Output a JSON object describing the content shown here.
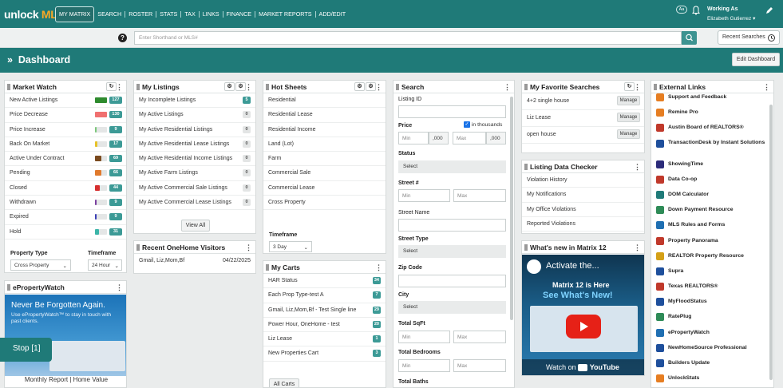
{
  "topbar": {
    "logo_unlock": "unlock",
    "logo_mls": "MLS",
    "nav": [
      "MY MATRIX",
      "SEARCH",
      "ROSTER",
      "STATS",
      "TAX",
      "LINKS",
      "FINANCE",
      "MARKET REPORTS",
      "ADD/EDIT"
    ],
    "aa": "Aa",
    "working_as": "Working As",
    "user": "Elizabeth Gutierrez"
  },
  "search": {
    "placeholder": "Enter Shorthand or MLS#",
    "recent": "Recent Searches"
  },
  "dashboard": {
    "title": "Dashboard",
    "edit": "Edit Dashboard"
  },
  "market_watch": {
    "title": "Market Watch",
    "rows": [
      {
        "label": "New Active Listings",
        "color": "#2e8b2e",
        "fill": 1.0,
        "count": "127"
      },
      {
        "label": "Price Decrease",
        "color": "#f07070",
        "fill": 1.0,
        "count": "130"
      },
      {
        "label": "Price Increase",
        "color": "#7bc77b",
        "fill": 0.15,
        "count": "9"
      },
      {
        "label": "Back On Market",
        "color": "#e6c229",
        "fill": 0.2,
        "count": "17"
      },
      {
        "label": "Active Under Contract",
        "color": "#7a4a1e",
        "fill": 0.55,
        "count": "69"
      },
      {
        "label": "Pending",
        "color": "#e07a2c",
        "fill": 0.55,
        "count": "66"
      },
      {
        "label": "Closed",
        "color": "#d62f2f",
        "fill": 0.4,
        "count": "44"
      },
      {
        "label": "Withdrawn",
        "color": "#7a3fa0",
        "fill": 0.12,
        "count": "9"
      },
      {
        "label": "Expired",
        "color": "#3b3fb5",
        "fill": 0.12,
        "count": "9"
      },
      {
        "label": "Hold",
        "color": "#3bb5a8",
        "fill": 0.3,
        "count": "31"
      }
    ],
    "property_type_label": "Property Type",
    "property_type_value": "Cross Property",
    "timeframe_label": "Timeframe",
    "timeframe_value": "24 Hour"
  },
  "epropertywatch": {
    "title": "ePropertyWatch",
    "headline": "Never Be Forgotten Again.",
    "subtext": "Use ePropertyWatch™ to stay in touch with past clients.",
    "stop": "Stop [1]",
    "caption": "Monthly Report | Home Value"
  },
  "my_listings": {
    "title": "My Listings",
    "rows": [
      {
        "label": "My Incomplete Listings",
        "count": "5",
        "zero": false
      },
      {
        "label": "My Active Listings",
        "count": "0",
        "zero": true
      },
      {
        "label": "My Active Residential Listings",
        "count": "0",
        "zero": true
      },
      {
        "label": "My Active Residential Lease Listings",
        "count": "0",
        "zero": true
      },
      {
        "label": "My Active Residential Income Listings",
        "count": "0",
        "zero": true
      },
      {
        "label": "My Active Farm Listings",
        "count": "0",
        "zero": true
      },
      {
        "label": "My Active Commercial Sale Listings",
        "count": "0",
        "zero": true
      },
      {
        "label": "My Active Commercial Lease Listings",
        "count": "0",
        "zero": true
      }
    ],
    "view_all": "View All"
  },
  "onehome": {
    "title": "Recent OneHome Visitors",
    "name": "Gmail, Liz,Mom,Bf",
    "date": "04/22/2025"
  },
  "hot_sheets": {
    "title": "Hot Sheets",
    "rows": [
      "Residential",
      "Residential Lease",
      "Residential Income",
      "Land (Lot)",
      "Farm",
      "Commercial Sale",
      "Commercial Lease",
      "Cross Property"
    ],
    "timeframe_label": "Timeframe",
    "timeframe_value": "3 Day"
  },
  "my_carts": {
    "title": "My Carts",
    "rows": [
      {
        "label": "HAR Status",
        "count": "34"
      },
      {
        "label": "Each Prop Type-test A",
        "count": "7"
      },
      {
        "label": "Gmail, Liz,Mom,Bf - Test Single line",
        "count": "29"
      },
      {
        "label": "Power Hour, OneHome - test",
        "count": "20"
      },
      {
        "label": "Liz Lease",
        "count": "1"
      },
      {
        "label": "New Properties Cart",
        "count": "3"
      }
    ],
    "all": "All Carts"
  },
  "search_panel": {
    "title": "Search",
    "listing_id": "Listing ID",
    "price": "Price",
    "in_thousands": "in thousands",
    "min": "Min",
    "max": "Max",
    "thousands_suffix": ",000",
    "status": "Status",
    "select": "Select",
    "street_no": "Street #",
    "street_name": "Street Name",
    "street_type": "Street Type",
    "zip": "Zip Code",
    "city": "City",
    "total_sqft": "Total SqFt",
    "total_bedrooms": "Total Bedrooms",
    "total_baths": "Total Baths"
  },
  "favorites": {
    "title": "My Favorite Searches",
    "rows": [
      "4+2 single house",
      "Liz Lease",
      "open house"
    ],
    "manage": "Manage"
  },
  "data_checker": {
    "title": "Listing Data Checker",
    "rows": [
      "Violation History",
      "My Notifications",
      "My Office Violations",
      "Reported Violations"
    ]
  },
  "whats_new": {
    "title": "What's new in Matrix 12",
    "video_title": "Activate the...",
    "line1": "Matrix 12 is Here",
    "line2": "See What's New!",
    "watch_on": "Watch on",
    "youtube": "YouTube"
  },
  "external_links": {
    "title": "External Links",
    "rows": [
      {
        "label": "Support and Feedback",
        "color": "#e67e22"
      },
      {
        "label": "Remine Pro",
        "color": "#e67e22"
      },
      {
        "label": "Austin Board of REALTORS®",
        "color": "#c0392b"
      },
      {
        "label": "TransactionDesk by Instant Solutions",
        "color": "#1e4f9c"
      },
      {
        "label": "ShowingTime",
        "color": "#2b2b7a"
      },
      {
        "label": "Data Co-op",
        "color": "#c0392b"
      },
      {
        "label": "DOM Calculator",
        "color": "#1f7a78"
      },
      {
        "label": "Down Payment Resource",
        "color": "#2e8b57"
      },
      {
        "label": "MLS Rules and Forms",
        "color": "#1f6fb2"
      },
      {
        "label": "Property Panorama",
        "color": "#c0392b"
      },
      {
        "label": "REALTOR Property Resource",
        "color": "#d4a017"
      },
      {
        "label": "Supra",
        "color": "#1e4f9c"
      },
      {
        "label": "Texas REALTORS®",
        "color": "#c0392b"
      },
      {
        "label": "MyFloodStatus",
        "color": "#1e4f9c"
      },
      {
        "label": "RatePlug",
        "color": "#2e8b57"
      },
      {
        "label": "ePropertyWatch",
        "color": "#1f6fb2"
      },
      {
        "label": "NewHomeSource Professional",
        "color": "#1e4f9c"
      },
      {
        "label": "Builders Update",
        "color": "#1e4f9c"
      },
      {
        "label": "UnlockStats",
        "color": "#e67e22"
      }
    ]
  }
}
